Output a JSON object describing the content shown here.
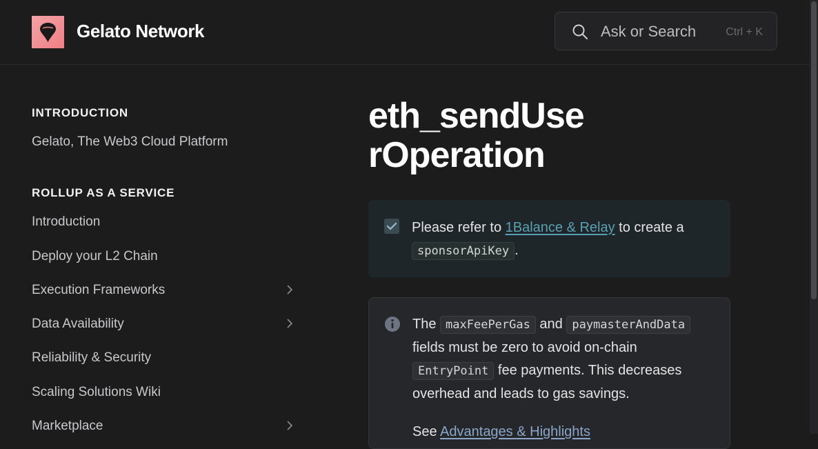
{
  "header": {
    "site_title": "Gelato Network",
    "search_placeholder": "Ask or Search",
    "search_shortcut": "Ctrl + K"
  },
  "sidebar": {
    "sections": [
      {
        "title": "INTRODUCTION"
      },
      {
        "title": "ROLLUP AS A SERVICE"
      }
    ],
    "items": [
      {
        "label": "Gelato, The Web3 Cloud Platform",
        "expandable": false
      },
      {
        "label": "Introduction",
        "expandable": false
      },
      {
        "label": "Deploy your L2 Chain",
        "expandable": false
      },
      {
        "label": "Execution Frameworks",
        "expandable": true
      },
      {
        "label": "Data Availability",
        "expandable": true
      },
      {
        "label": "Reliability & Security",
        "expandable": false
      },
      {
        "label": "Scaling Solutions Wiki",
        "expandable": false
      },
      {
        "label": "Marketplace",
        "expandable": true
      }
    ]
  },
  "main": {
    "title": "eth_sendUserOperation",
    "callout_success": {
      "text_before": "Please refer to ",
      "link": "1Balance & Relay",
      "text_after": " to create a ",
      "code": "sponsorApiKey",
      "end": "."
    },
    "callout_info": {
      "t1": "The ",
      "code1": "maxFeePerGas",
      "t2": " and ",
      "code2": "paymasterAndData",
      "t3": " fields must be zero to avoid on-chain ",
      "code3": "EntryPoint",
      "t4": " fee payments. This decreases overhead and leads to gas savings.",
      "see": "See ",
      "see_link": "Advantages & Highlights"
    }
  },
  "colors": {
    "background": "#1c1c1d",
    "accent_link": "#5aa1b3",
    "logo_gradient_start": "#f3a3a5"
  }
}
